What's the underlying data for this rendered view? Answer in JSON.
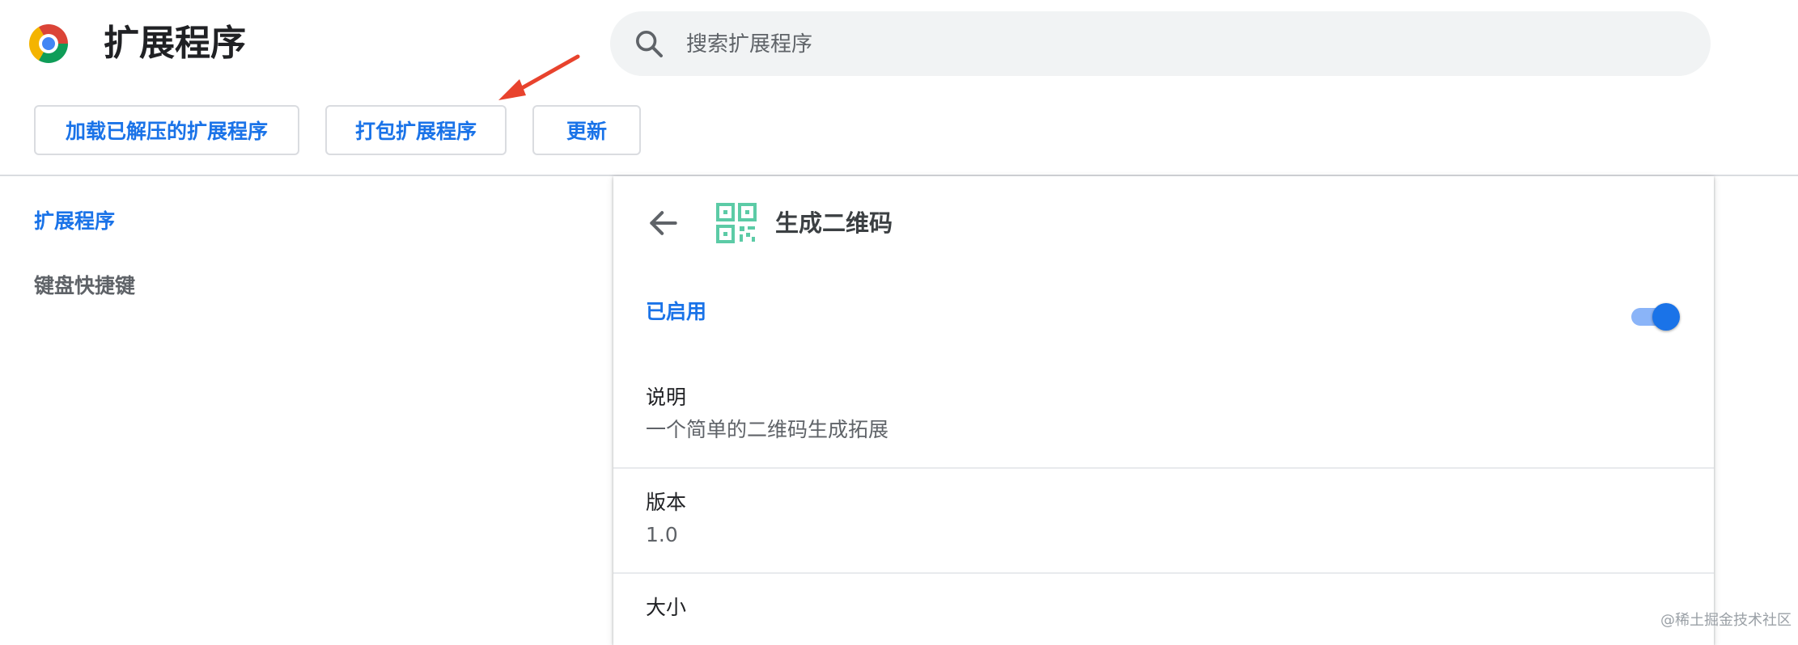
{
  "header": {
    "title": "扩展程序",
    "logo_icon": "chrome-logo-icon",
    "search": {
      "placeholder": "搜索扩展程序",
      "icon": "search-icon"
    }
  },
  "toolbar": {
    "load_unpacked_label": "加载已解压的扩展程序",
    "pack_label": "打包扩展程序",
    "update_label": "更新"
  },
  "annotation": {
    "arrow_icon": "red-arrow-icon",
    "arrow_color": "#e8432d"
  },
  "sidebar": {
    "items": [
      {
        "label": "扩展程序",
        "active": true
      },
      {
        "label": "键盘快捷键",
        "active": false
      }
    ]
  },
  "detail": {
    "back_icon": "back-arrow-icon",
    "extension_icon": "qr-code-icon",
    "extension_name": "生成二维码",
    "enabled_label": "已启用",
    "enabled": true,
    "sections": [
      {
        "label": "说明",
        "value": "一个简单的二维码生成拓展"
      },
      {
        "label": "版本",
        "value": "1.0"
      },
      {
        "label": "大小",
        "value": ""
      }
    ]
  },
  "watermark": "@稀土掘金技术社区",
  "colors": {
    "accent": "#1a73e8",
    "toggle_track": "#8ab4f8",
    "qr_icon": "#5ccba6",
    "divider": "#dadce0"
  }
}
